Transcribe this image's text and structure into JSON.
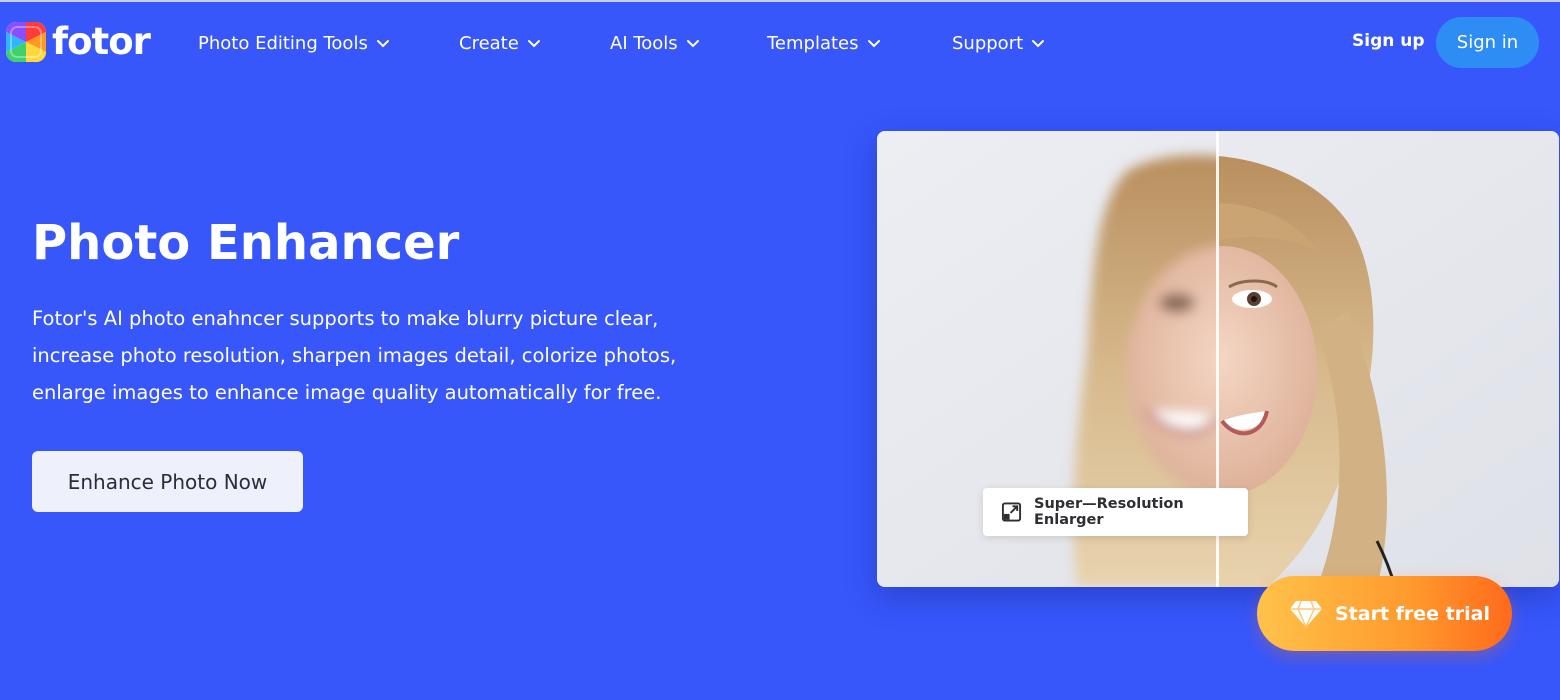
{
  "brand": {
    "name": "fotor"
  },
  "nav": {
    "items": [
      {
        "label": "Photo Editing Tools"
      },
      {
        "label": "Create"
      },
      {
        "label": "AI Tools"
      },
      {
        "label": "Templates"
      },
      {
        "label": "Support"
      }
    ],
    "signup_label": "Sign up",
    "signin_label": "Sign in"
  },
  "hero": {
    "title": "Photo Enhancer",
    "description_lines": [
      "Fotor's AI photo enahncer supports to make blurry picture clear,",
      "increase photo resolution, sharpen images detail, colorize photos,",
      "enlarge images to enhance image quality automatically for free."
    ],
    "cta_label": "Enhance Photo Now",
    "badge_label": "Super—Resolution Enlarger",
    "trial_label": "Start free trial"
  },
  "icons": {
    "chevron": "chevron-down-icon",
    "badge": "expand-arrow-icon",
    "trial": "diamond-icon"
  },
  "colors": {
    "background": "#3757fb",
    "signin_bg": "#2e8cf5",
    "cta_bg": "#eef0fb",
    "trial_gradient_start": "#ffc24a",
    "trial_gradient_end": "#ff6a1a"
  }
}
